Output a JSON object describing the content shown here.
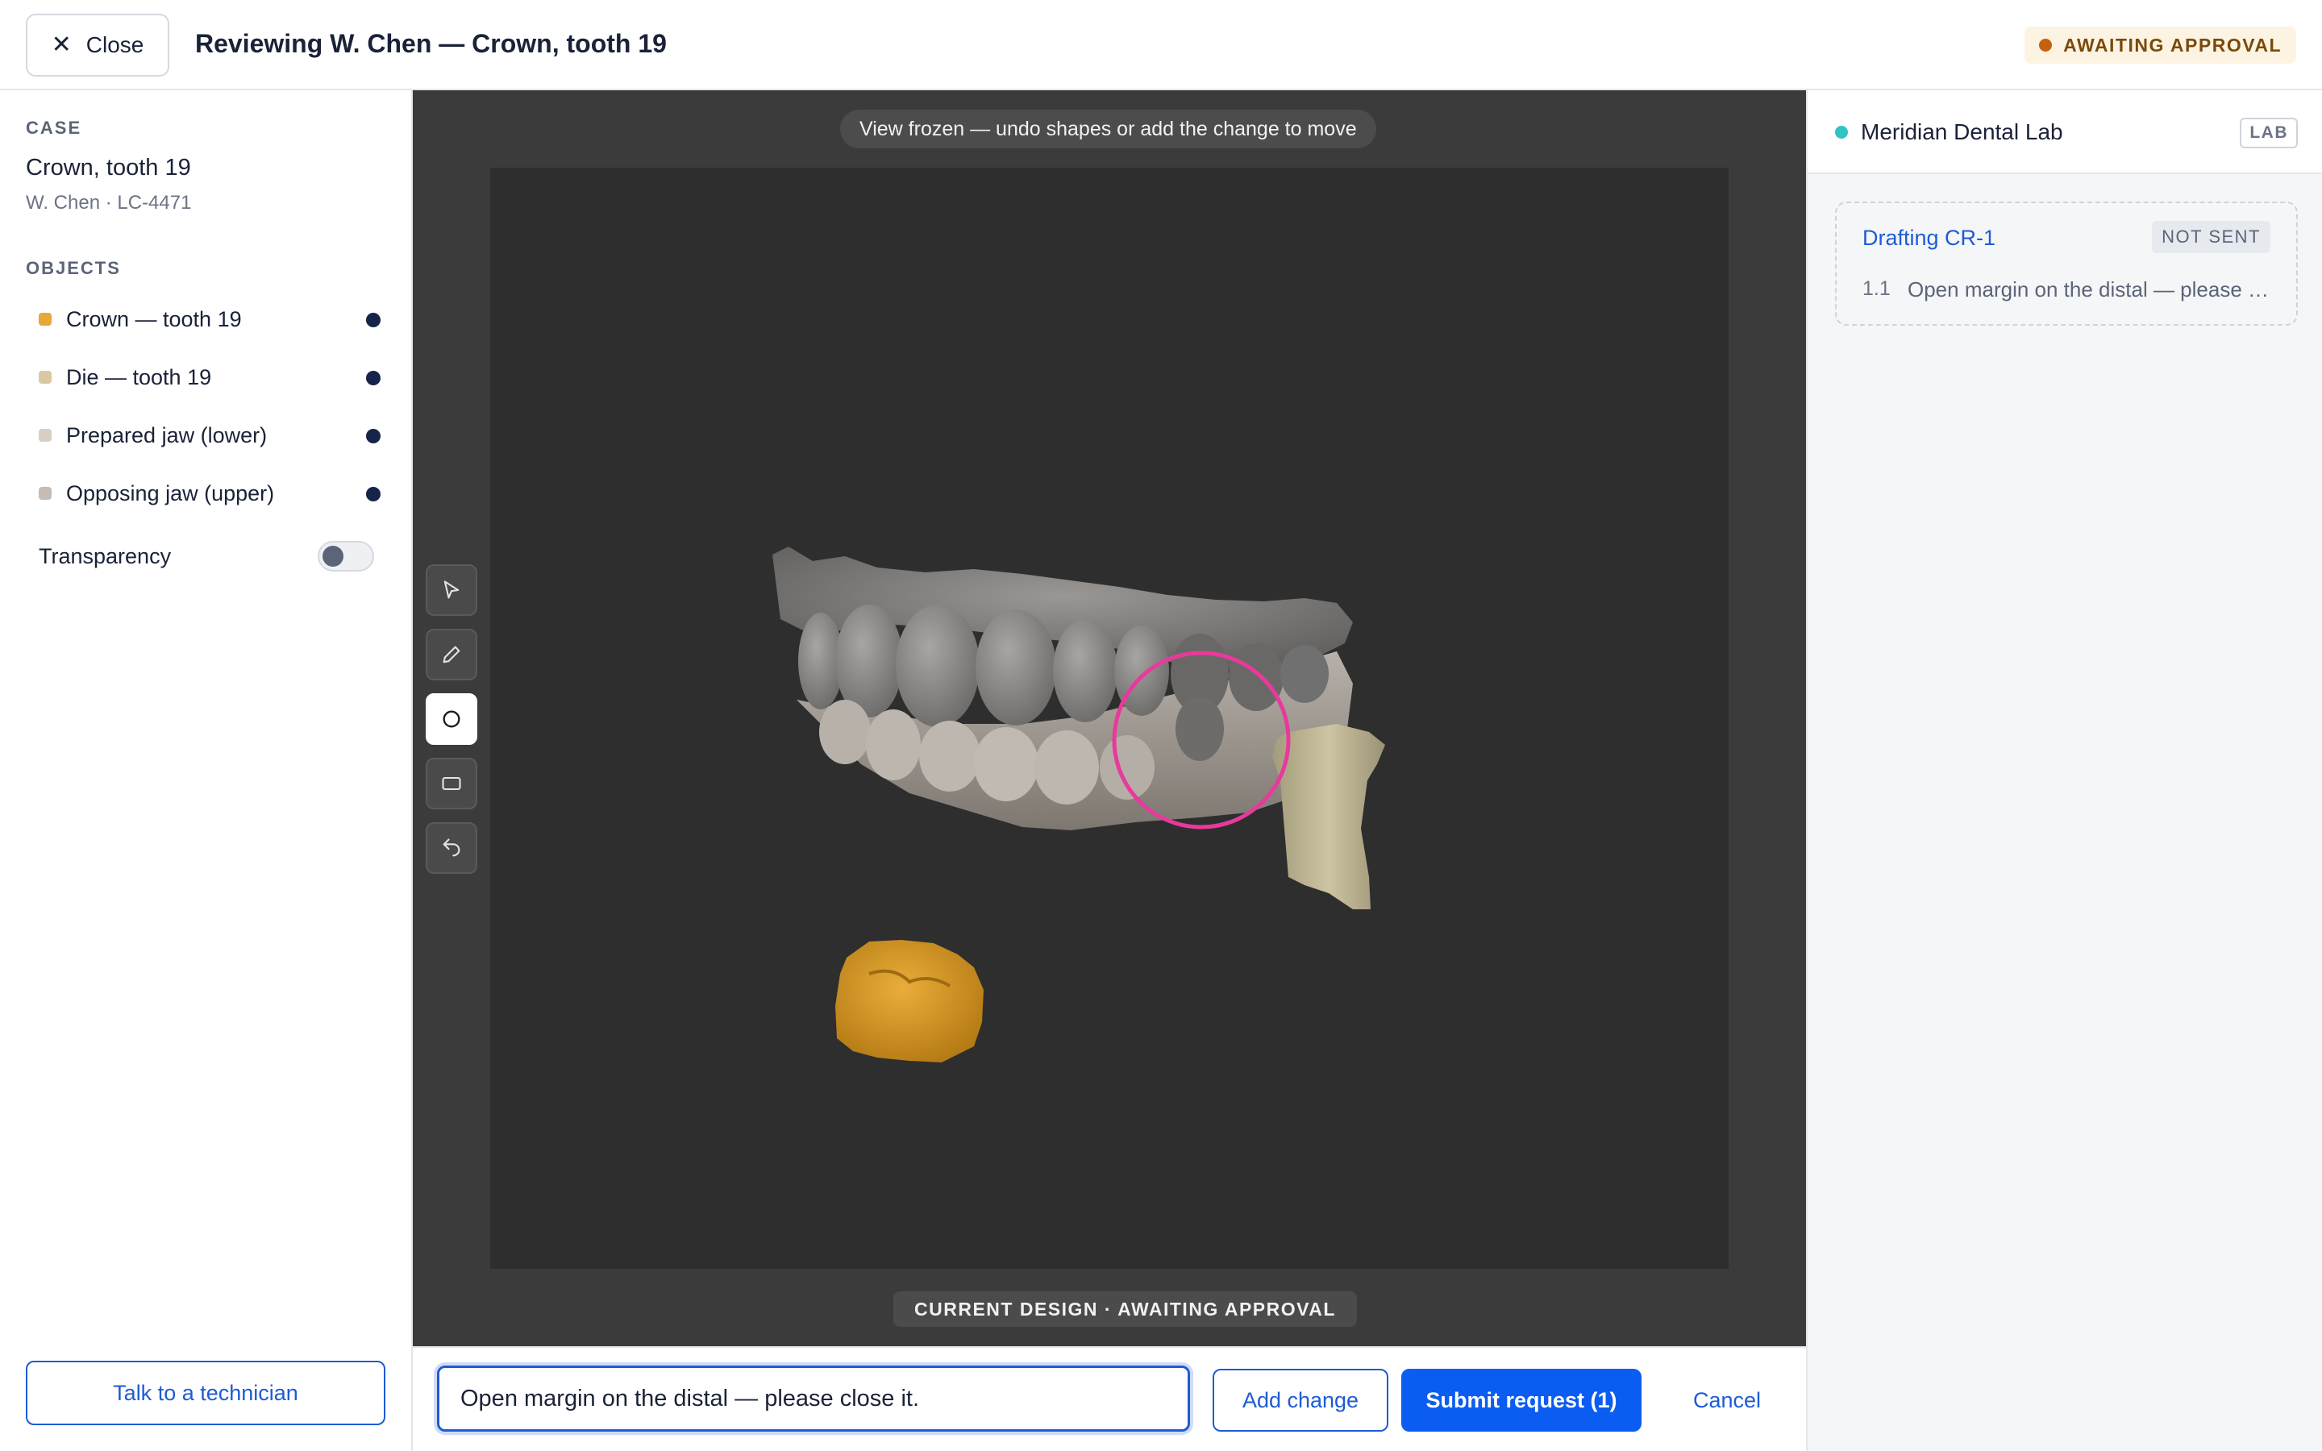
{
  "header": {
    "close_label": "Close",
    "title": "Reviewing W. Chen — Crown, tooth 19",
    "status": "AWAITING APPROVAL",
    "status_color": "#c4610f"
  },
  "sidebar": {
    "case_heading": "CASE",
    "case_title": "Crown, tooth 19",
    "case_sub": "W. Chen · LC-4471",
    "objects_heading": "OBJECTS",
    "objects": [
      {
        "label": "Crown — tooth 19",
        "color": "#e6a838",
        "visible": true
      },
      {
        "label": "Die — tooth 19",
        "color": "#d9c9a3",
        "visible": true
      },
      {
        "label": "Prepared jaw (lower)",
        "color": "#d8cec4",
        "visible": true
      },
      {
        "label": "Opposing jaw (upper)",
        "color": "#c4bcb5",
        "visible": true
      }
    ],
    "transparency_label": "Transparency",
    "transparency_on": false,
    "technician_button": "Talk to a technician"
  },
  "viewer": {
    "frozen_notice": "View frozen — undo shapes or add the change to move",
    "design_label": "CURRENT DESIGN · AWAITING APPROVAL",
    "tools": [
      {
        "name": "select-tool",
        "icon": "pointer-icon",
        "active": false
      },
      {
        "name": "draw-tool",
        "icon": "pencil-icon",
        "active": false
      },
      {
        "name": "circle-tool",
        "icon": "circle-icon",
        "active": true
      },
      {
        "name": "rectangle-tool",
        "icon": "rectangle-icon",
        "active": false
      },
      {
        "name": "undo-tool",
        "icon": "undo-icon",
        "active": false
      }
    ],
    "annotation_color": "#e8399c"
  },
  "composer": {
    "input_value": "Open margin on the distal — please close it.",
    "add_label": "Add change",
    "submit_label": "Submit request (1)",
    "cancel_label": "Cancel"
  },
  "right_panel": {
    "lab_name": "Meridian Dental Lab",
    "lab_tag": "LAB",
    "draft_title": "Drafting CR-1",
    "draft_status": "NOT SENT",
    "draft_item_number": "1.1",
    "draft_item_text": "Open margin on the distal — please close it."
  }
}
